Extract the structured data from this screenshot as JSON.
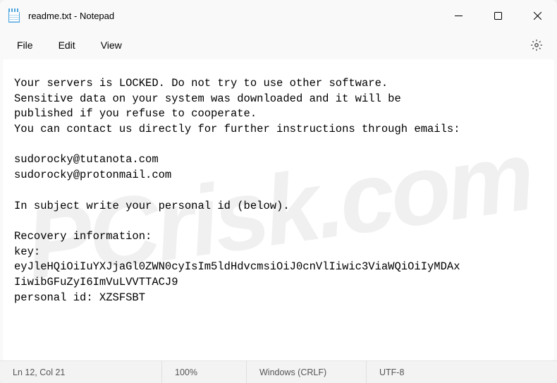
{
  "titlebar": {
    "title": "readme.txt - Notepad"
  },
  "menu": {
    "file": "File",
    "edit": "Edit",
    "view": "View"
  },
  "document": {
    "text": "Your servers is LOCKED. Do not try to use other software.\nSensitive data on your system was downloaded and it will be\npublished if you refuse to cooperate.\nYou can contact us directly for further instructions through emails:\n\nsudorocky@tutanota.com\nsudorocky@protonmail.com\n\nIn subject write your personal id (below).\n\nRecovery information:\nkey:\neyJleHQiOiIuYXJjaGl0ZWN0cyIsIm5ldHdvcmsiOiJ0cnVlIiwic3ViaWQiOiIyMDAx\nIiwibGFuZyI6ImVuLVVTTACJ9\npersonal id: XZSFSBT"
  },
  "statusbar": {
    "position": "Ln 12, Col 21",
    "zoom": "100%",
    "eol": "Windows (CRLF)",
    "encoding": "UTF-8"
  },
  "watermark": "PCrisk.com"
}
